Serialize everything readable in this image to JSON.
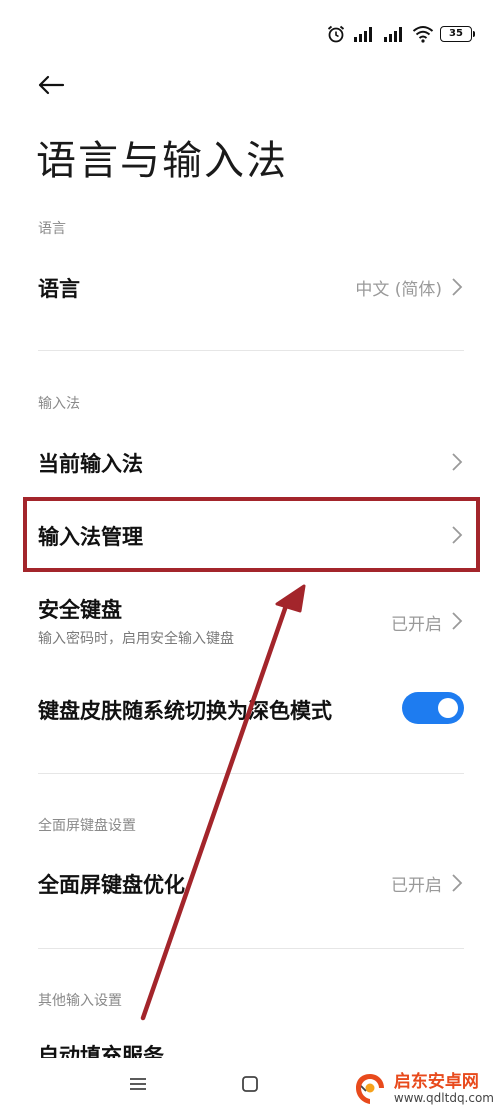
{
  "status_bar": {
    "signal_label_1": "HD",
    "signal_label_2": "HD",
    "battery": "35"
  },
  "header": {
    "title": "语言与输入法"
  },
  "sections": {
    "language": {
      "header": "语言",
      "row_title": "语言",
      "row_value": "中文 (简体)"
    },
    "input_method": {
      "header": "输入法",
      "current_title": "当前输入法",
      "manage_title": "输入法管理",
      "secure_title": "安全键盘",
      "secure_subtitle": "输入密码时，启用安全输入键盘",
      "secure_value": "已开启",
      "dark_mode_title": "键盘皮肤随系统切换为深色模式",
      "dark_mode_enabled": true
    },
    "fullscreen": {
      "header": "全面屏键盘设置",
      "row_title": "全面屏键盘优化",
      "row_value": "已开启"
    },
    "other": {
      "header": "其他输入设置",
      "partial_row_title": "自动填充服务"
    }
  },
  "annotation": {
    "box_color": "#a3252b",
    "arrow_color": "#a3252b"
  },
  "colors": {
    "toggle_on": "#1e7cf0",
    "watermark_accent": "#e84a1c"
  },
  "watermark": {
    "name": "启东安卓网",
    "url": "www.qdltdq.com"
  }
}
